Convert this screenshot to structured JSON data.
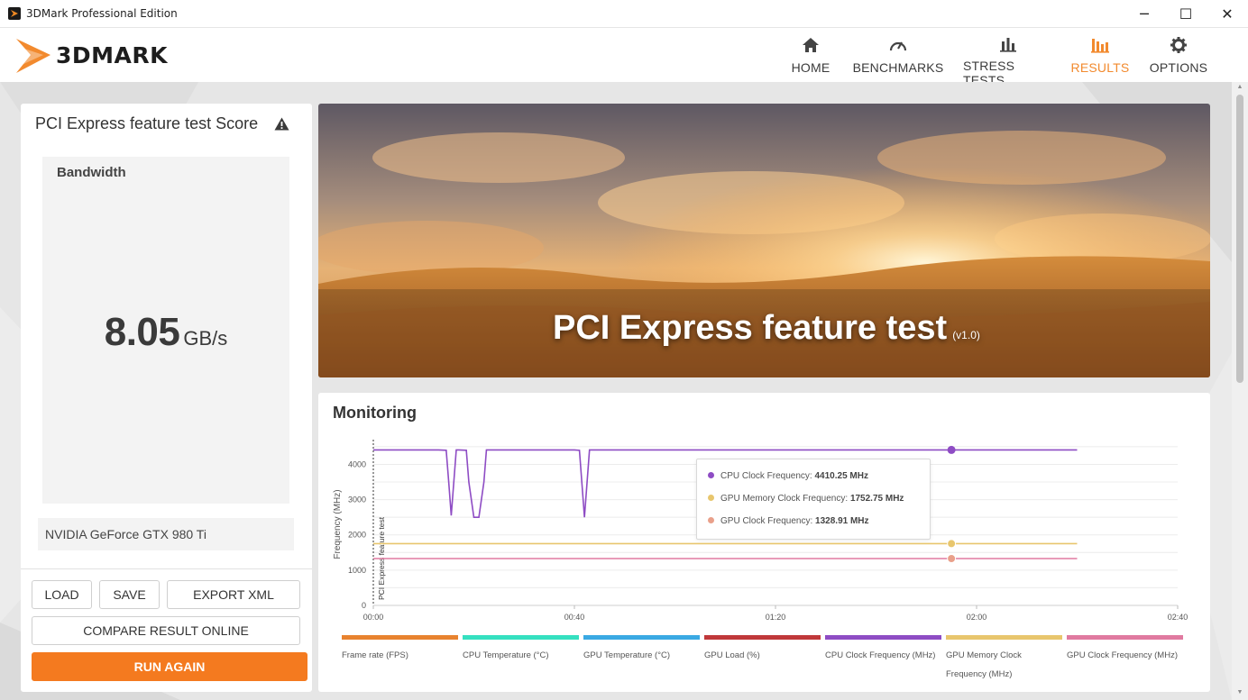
{
  "window": {
    "title": "3DMark Professional Edition",
    "minimize": "─",
    "maximize": "☐",
    "close": "✕"
  },
  "header": {
    "logo_text": "3DMARK",
    "nav": [
      {
        "label": "HOME",
        "icon": "home-icon"
      },
      {
        "label": "BENCHMARKS",
        "icon": "gauge-icon"
      },
      {
        "label": "STRESS TESTS",
        "icon": "bar-chart-icon"
      },
      {
        "label": "RESULTS",
        "icon": "results-icon",
        "active": true
      },
      {
        "label": "OPTIONS",
        "icon": "gear-icon"
      }
    ],
    "accent_color": "#f28a2e"
  },
  "score_panel": {
    "title": "PCI Express feature test Score",
    "metric_label": "Bandwidth",
    "score_value": "8.05",
    "score_unit": "GB/s",
    "gpu_name": "NVIDIA GeForce GTX 980 Ti",
    "buttons": {
      "load": "LOAD",
      "save": "SAVE",
      "export_xml": "EXPORT XML",
      "compare": "COMPARE RESULT ONLINE",
      "run_again": "RUN AGAIN"
    },
    "run_again_color": "#f47a1f"
  },
  "banner": {
    "title": "PCI Express feature test",
    "version": "(v1.0)"
  },
  "monitoring": {
    "title": "Monitoring",
    "tooltip": [
      {
        "label": "CPU Clock Frequency:",
        "value": "4410.25 MHz",
        "color": "#8e4cc4"
      },
      {
        "label": "GPU Memory Clock Frequency:",
        "value": "1752.75 MHz",
        "color": "#e8c66d"
      },
      {
        "label": "GPU Clock Frequency:",
        "value": "1328.91 MHz",
        "color": "#e9a08a"
      }
    ],
    "legend": [
      {
        "label": "Frame rate (FPS)",
        "color": "#e8832f"
      },
      {
        "label": "CPU Temperature (°C)",
        "color": "#35e0c0"
      },
      {
        "label": "GPU Temperature (°C)",
        "color": "#3aa9e3"
      },
      {
        "label": "GPU Load (%)",
        "color": "#c0383a"
      },
      {
        "label": "CPU Clock Frequency (MHz)",
        "color": "#8e4cc4"
      },
      {
        "label": "GPU Memory Clock Frequency (MHz)",
        "color": "#e8c66d"
      },
      {
        "label": "GPU Clock Frequency (MHz)",
        "color": "#e07aa0"
      }
    ]
  },
  "chart_data": {
    "type": "line",
    "ylabel": "Frequency (MHz)",
    "marker_label": "PCI Express feature test",
    "ylim": [
      0,
      4600
    ],
    "yticks": [
      0,
      1000,
      2000,
      3000,
      4000
    ],
    "xlim_seconds": [
      0,
      160
    ],
    "xticks": [
      "00:00",
      "00:40",
      "01:20",
      "02:00",
      "02:40"
    ],
    "grid": true,
    "series": [
      {
        "name": "CPU Clock Frequency (MHz)",
        "color": "#8e4cc4",
        "x": [
          0,
          13,
          14.5,
          15,
          15.5,
          16.5,
          17,
          18.5,
          19,
          20,
          20.5,
          21,
          22,
          22.5,
          24,
          40,
          41,
          42,
          43,
          44,
          45,
          70,
          140
        ],
        "y": [
          4410,
          4410,
          4400,
          3500,
          2550,
          4410,
          4410,
          4400,
          3500,
          2500,
          2500,
          2500,
          3500,
          4410,
          4410,
          4410,
          4400,
          2500,
          4410,
          4410,
          4410,
          4410,
          4410
        ]
      },
      {
        "name": "GPU Memory Clock Frequency (MHz)",
        "color": "#e8c66d",
        "x": [
          0,
          140
        ],
        "y": [
          1752.75,
          1752.75
        ]
      },
      {
        "name": "GPU Clock Frequency (MHz)",
        "color": "#e07aa0",
        "x": [
          0,
          140
        ],
        "y": [
          1328.91,
          1328.91
        ]
      }
    ],
    "hover_x": 115
  }
}
